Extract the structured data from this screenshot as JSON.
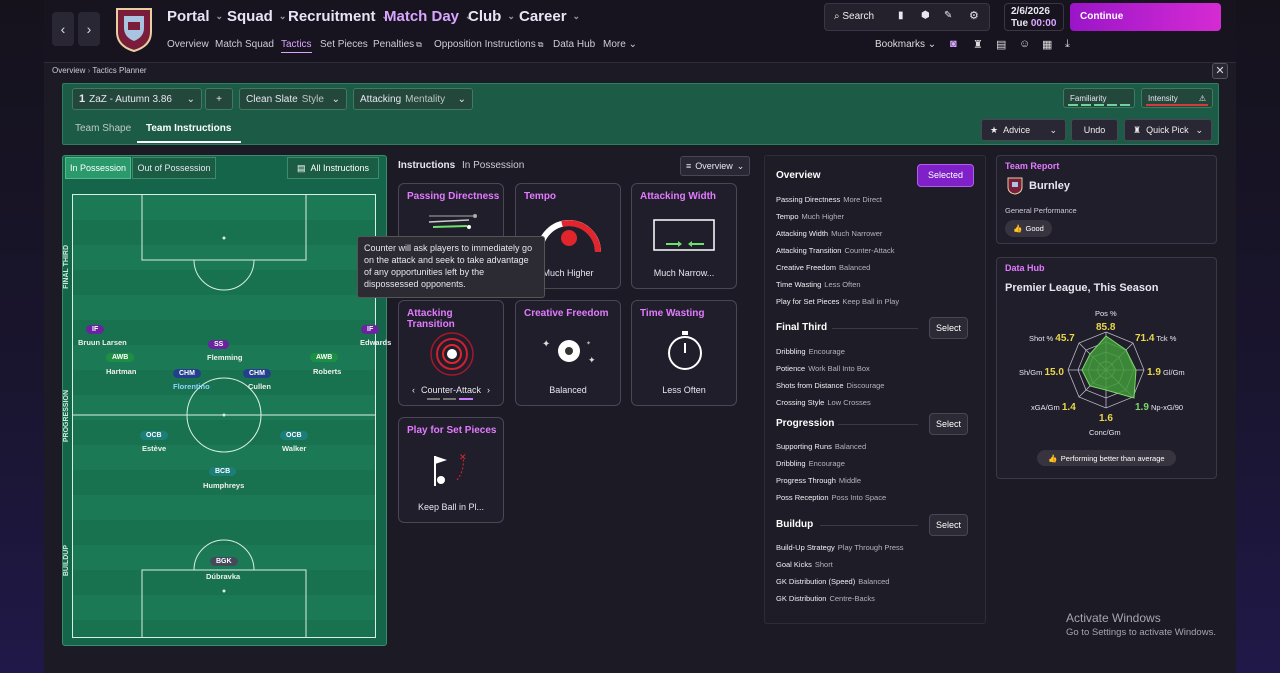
{
  "nav": {
    "menus": [
      "Portal",
      "Squad",
      "Recruitment",
      "Match Day",
      "Club",
      "Career"
    ],
    "subtabs": [
      "Overview",
      "Match Squad",
      "Tactics",
      "Set Pieces",
      "Penalties",
      "Opposition Instructions",
      "Data Hub",
      "More"
    ],
    "search_label": "Search",
    "date": "2/6/2026",
    "day": "Tue",
    "time": "00:00",
    "continue_label": "Continue",
    "bookmarks_label": "Bookmarks"
  },
  "breadcrumb": {
    "root": "Overview",
    "current": "Tactics Planner"
  },
  "tactic": {
    "number": "1",
    "name": "ZaZ - Autumn 3.86",
    "add": "+",
    "style_value": "Clean Slate",
    "style_label": "Style",
    "mentality_value": "Attacking",
    "mentality_label": "Mentality",
    "familiarity": "Familiarity",
    "intensity": "Intensity"
  },
  "tabs": {
    "team_shape": "Team Shape",
    "team_instructions": "Team Instructions"
  },
  "right_buttons": {
    "advice": "Advice",
    "undo": "Undo",
    "quick_pick": "Quick Pick"
  },
  "pitch": {
    "tab_in": "In Possession",
    "tab_out": "Out of Possession",
    "all_instructions": "All Instructions",
    "zones": [
      "FINAL THIRD",
      "PROGRESSION",
      "BUILDUP"
    ],
    "players": [
      {
        "pos": "IF",
        "name": "Bruun Larsen"
      },
      {
        "pos": "SS",
        "name": "Flemming"
      },
      {
        "pos": "IF",
        "name": "Edwards"
      },
      {
        "pos": "AWB",
        "name": "Hartman"
      },
      {
        "pos": "AWB",
        "name": "Roberts"
      },
      {
        "pos": "CHM",
        "name": "Florentino"
      },
      {
        "pos": "CHM",
        "name": "Cullen"
      },
      {
        "pos": "OCB",
        "name": "Estève"
      },
      {
        "pos": "OCB",
        "name": "Walker"
      },
      {
        "pos": "BCB",
        "name": "Humphreys"
      },
      {
        "pos": "BGK",
        "name": "Dúbravka"
      }
    ]
  },
  "instructions": {
    "header": "Instructions",
    "subheader": "In Possession",
    "view": "Overview",
    "cards": [
      {
        "title": "Passing Directness",
        "value": ""
      },
      {
        "title": "Tempo",
        "value": "Much Higher"
      },
      {
        "title": "Attacking Width",
        "value": "Much Narrow..."
      },
      {
        "title": "Attacking Transition",
        "value": "Counter-Attack"
      },
      {
        "title": "Creative Freedom",
        "value": "Balanced"
      },
      {
        "title": "Time Wasting",
        "value": "Less Often"
      },
      {
        "title": "Play for Set Pieces",
        "value": "Keep Ball in Pl..."
      }
    ],
    "tooltip": "Counter will ask players to immediately go on the attack and seek to take advantage of any opportunities left by the dispossessed opponents."
  },
  "overview": {
    "title": "Overview",
    "selected_label": "Selected",
    "select_label": "Select",
    "main": [
      [
        "Passing Directness",
        "More Direct"
      ],
      [
        "Tempo",
        "Much Higher"
      ],
      [
        "Attacking Width",
        "Much Narrower"
      ],
      [
        "Attacking Transition",
        "Counter-Attack"
      ],
      [
        "Creative Freedom",
        "Balanced"
      ],
      [
        "Time Wasting",
        "Less Often"
      ],
      [
        "Play for Set Pieces",
        "Keep Ball in Play"
      ]
    ],
    "final_third_title": "Final Third",
    "final_third": [
      [
        "Dribbling",
        "Encourage"
      ],
      [
        "Potience",
        "Work Ball Into Box"
      ],
      [
        "Shots from Distance",
        "Discourage"
      ],
      [
        "Crossing Style",
        "Low Crosses"
      ]
    ],
    "progression_title": "Progression",
    "progression": [
      [
        "Supporting Runs",
        "Balanced"
      ],
      [
        "Dribbling",
        "Encourage"
      ],
      [
        "Progress Through",
        "Middle"
      ],
      [
        "Poss Reception",
        "Poss Into Space"
      ]
    ],
    "buildup_title": "Buildup",
    "buildup": [
      [
        "Build-Up Strategy",
        "Play Through Press"
      ],
      [
        "Goal Kicks",
        "Short"
      ],
      [
        "GK Distribution (Speed)",
        "Balanced"
      ],
      [
        "GK Distribution",
        "Centre-Backs"
      ]
    ]
  },
  "team_report": {
    "title": "Team Report",
    "team": "Burnley",
    "perf_label": "General Performance",
    "perf_value": "Good"
  },
  "data_hub": {
    "title": "Data Hub",
    "subtitle": "Premier League, This Season",
    "badge": "Performing better than average",
    "stats": [
      {
        "label": "Pos %",
        "value": "85.8"
      },
      {
        "label": "Tck %",
        "value": "71.4"
      },
      {
        "label": "Gl/Gm",
        "value": "1.9"
      },
      {
        "label": "Np-xG/90",
        "value": "1.9"
      },
      {
        "label": "Conc/Gm",
        "value": "1.6"
      },
      {
        "label": "xGA/Gm",
        "value": "1.4"
      },
      {
        "label": "Sh/Gm",
        "value": "15.0"
      },
      {
        "label": "Shot %",
        "value": "45.7"
      }
    ]
  },
  "watermark": {
    "line1": "Activate Windows",
    "line2": "Go to Settings to activate Windows."
  },
  "colors": {
    "accent": "#d62bd3",
    "pitch": "#1b7a55",
    "card_title": "#e27bff",
    "stat": "#e9d84a"
  }
}
